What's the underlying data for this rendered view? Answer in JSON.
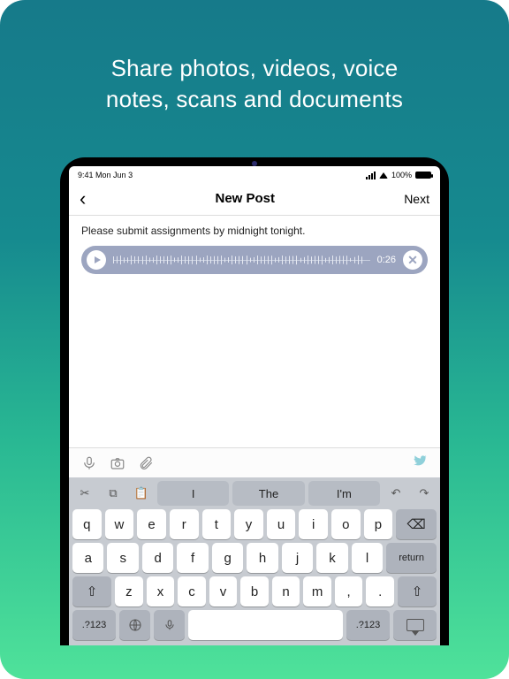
{
  "headline": {
    "line1": "Share photos, videos, voice",
    "line2": "notes, scans and documents"
  },
  "statusbar": {
    "time": "9:41",
    "date": "Mon Jun 3",
    "battery": "100%"
  },
  "nav": {
    "title": "New Post",
    "next": "Next"
  },
  "post": {
    "text": "Please submit assignments by midnight tonight."
  },
  "audio": {
    "duration": "0:26"
  },
  "suggestions": {
    "s1": "I",
    "s2": "The",
    "s3": "I'm"
  },
  "keys": {
    "row1": [
      "q",
      "w",
      "e",
      "r",
      "t",
      "y",
      "u",
      "i",
      "o",
      "p"
    ],
    "row2": [
      "a",
      "s",
      "d",
      "f",
      "g",
      "h",
      "j",
      "k",
      "l"
    ],
    "row3": [
      "z",
      "x",
      "c",
      "v",
      "b",
      "n",
      "m",
      ",",
      "."
    ],
    "backspace": "⌫",
    "return": "return",
    "shift_left": "⇧",
    "shift_right": "⇧",
    "symbols": ".?123",
    "globe": "🌐",
    "mic": "🎤"
  }
}
